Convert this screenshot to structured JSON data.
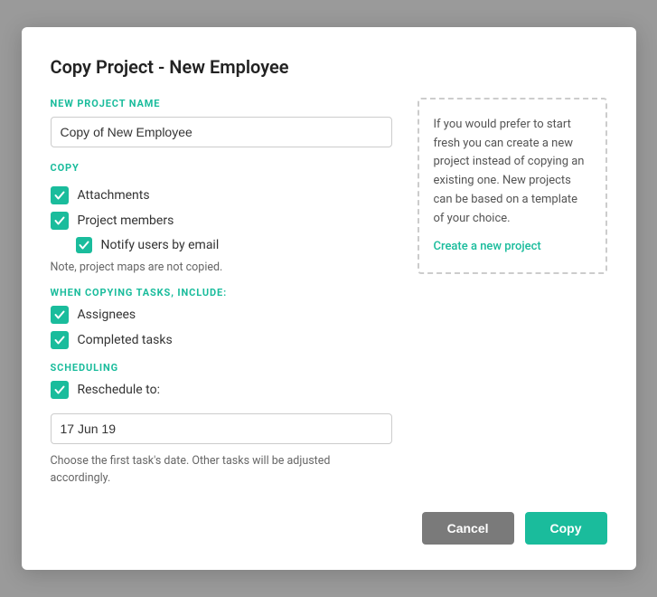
{
  "modal": {
    "title": "Copy Project - New Employee",
    "new_project_name_label": "NEW PROJECT NAME",
    "new_project_name_value": "Copy of New Employee",
    "copy_section_label": "COPY",
    "checkboxes": {
      "attachments": {
        "label": "Attachments",
        "checked": true
      },
      "project_members": {
        "label": "Project members",
        "checked": true
      },
      "notify_users": {
        "label": "Notify users by email",
        "checked": true
      }
    },
    "note": "Note, project maps are not copied.",
    "when_copying_label": "WHEN COPYING TASKS, INCLUDE:",
    "task_checkboxes": {
      "assignees": {
        "label": "Assignees",
        "checked": true
      },
      "completed_tasks": {
        "label": "Completed tasks",
        "checked": true
      }
    },
    "scheduling_label": "SCHEDULING",
    "reschedule_label": "Reschedule to:",
    "reschedule_checked": true,
    "date_value": "17 Jun 19",
    "schedule_note": "Choose the first task's date. Other tasks will be adjusted accordingly.",
    "info_text": "If you would prefer to start fresh you can create a new project instead of copying an existing one. New projects can be based on a template of your choice.",
    "create_link": "Create a new project",
    "cancel_label": "Cancel",
    "copy_label": "Copy"
  }
}
